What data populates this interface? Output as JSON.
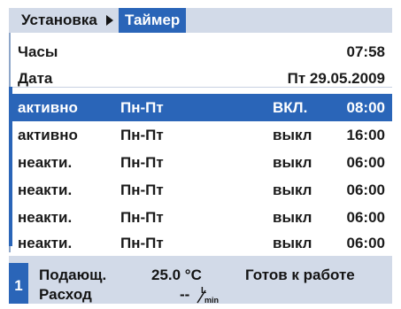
{
  "breadcrumb": {
    "parent": "Установка",
    "current": "Таймер"
  },
  "clock_row": {
    "label": "Часы",
    "value": "07:58"
  },
  "date_row": {
    "label": "Дата",
    "value": "Пт 29.05.2009"
  },
  "schedule": [
    {
      "status": "активно",
      "days": "Пн-Пт",
      "switch": "ВКЛ.",
      "time": "08:00",
      "selected": true
    },
    {
      "status": "активно",
      "days": "Пн-Пт",
      "switch": "выкл",
      "time": "16:00",
      "selected": false
    },
    {
      "status": "неакти.",
      "days": "Пн-Пт",
      "switch": "выкл",
      "time": "06:00",
      "selected": false
    },
    {
      "status": "неакти.",
      "days": "Пн-Пт",
      "switch": "выкл",
      "time": "06:00",
      "selected": false
    },
    {
      "status": "неакти.",
      "days": "Пн-Пт",
      "switch": "выкл",
      "time": "06:00",
      "selected": false
    },
    {
      "status": "неакти.",
      "days": "Пн-Пт",
      "switch": "выкл",
      "time": "06:00",
      "selected": false
    }
  ],
  "statusbar": {
    "zone": "1",
    "supply_label": "Подающ.",
    "supply_value": "25.0 °C",
    "flow_label": "Расход",
    "flow_value": "--",
    "flow_unit_top": "L",
    "flow_unit_bottom": "min",
    "state": "Готов к работе"
  },
  "colors": {
    "accent": "#2a65b8",
    "bar_background": "#d2dae8"
  }
}
